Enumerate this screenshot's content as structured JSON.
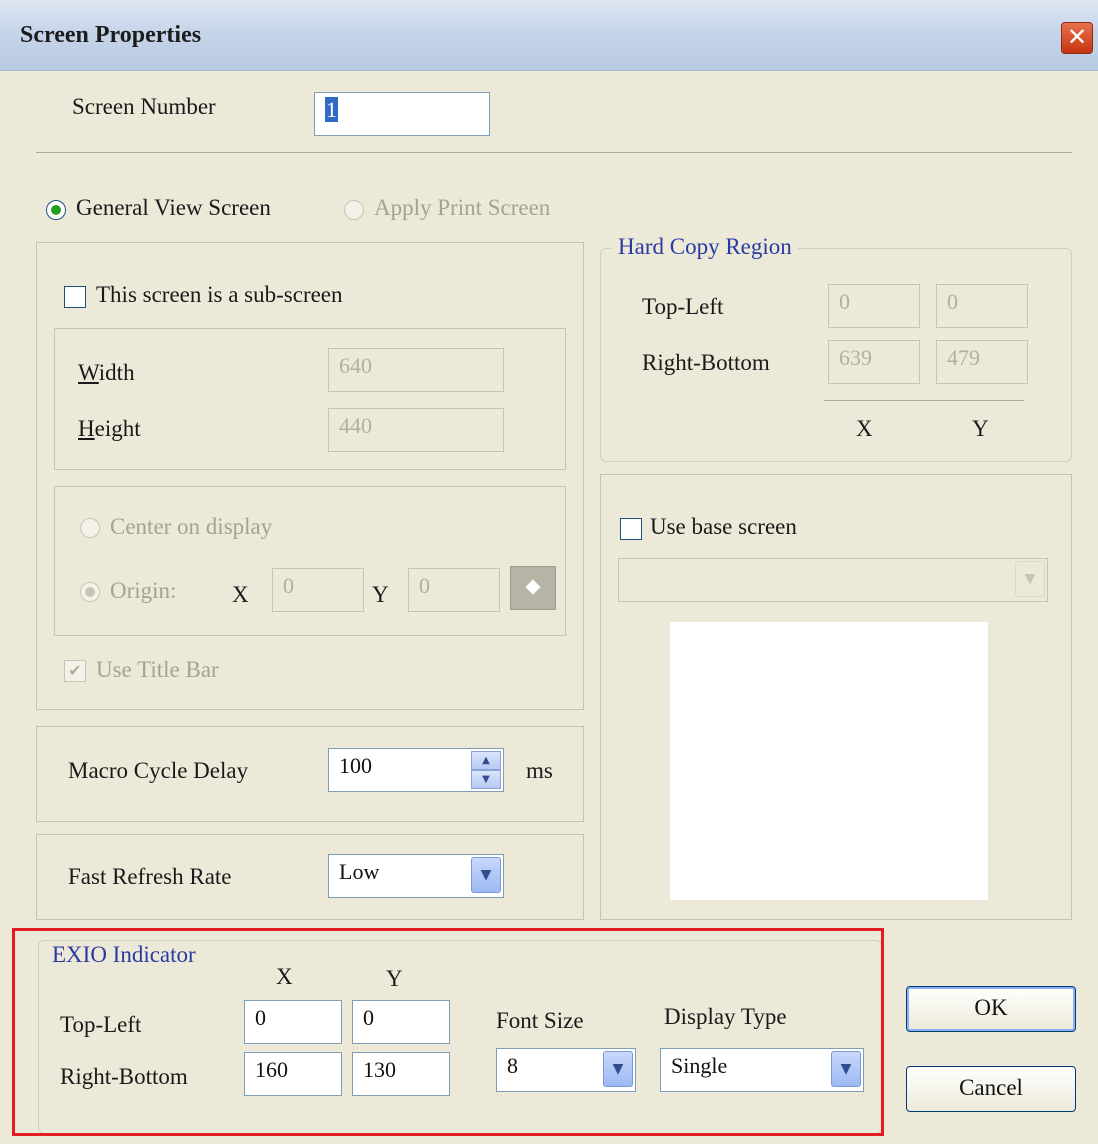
{
  "window": {
    "title": "Screen Properties",
    "close_symbol": "✕"
  },
  "screen_number": {
    "label": "Screen Number",
    "value": "1"
  },
  "screen_type": {
    "general": "General View Screen",
    "print": "Apply Print Screen"
  },
  "subscreen": {
    "checkbox_label": "This screen is a sub-screen",
    "width_label_u": "W",
    "width_label_rest": "idth",
    "width_value": "640",
    "height_label_u": "H",
    "height_label_rest": "eight",
    "height_value": "440",
    "center_label": "Center on display",
    "origin_label": "Origin:",
    "x_label": "X",
    "x_value": "0",
    "y_label": "Y",
    "y_value": "0",
    "use_title_bar": "Use Title Bar"
  },
  "hard_copy": {
    "legend": "Hard Copy Region",
    "top_left_label": "Top-Left",
    "top_left_x": "0",
    "top_left_y": "0",
    "right_bottom_label": "Right-Bottom",
    "right_bottom_x": "639",
    "right_bottom_y": "479",
    "x_header": "X",
    "y_header": "Y"
  },
  "base_screen": {
    "checkbox_label": "Use base screen",
    "selected": ""
  },
  "macro": {
    "label": "Macro Cycle Delay",
    "value": "100",
    "unit": "ms"
  },
  "refresh": {
    "label": "Fast Refresh Rate",
    "value": "Low"
  },
  "exio": {
    "legend": "EXIO Indicator",
    "x_header": "X",
    "y_header": "Y",
    "top_left_label": "Top-Left",
    "top_left_x": "0",
    "top_left_y": "0",
    "right_bottom_label": "Right-Bottom",
    "right_bottom_x": "160",
    "right_bottom_y": "130",
    "font_size_label": "Font Size",
    "font_size_value": "8",
    "display_type_label": "Display Type",
    "display_type_value": "Single"
  },
  "buttons": {
    "ok": "OK",
    "cancel": "Cancel"
  },
  "icons": {
    "dropdown": "▼",
    "spin_up": "▲",
    "spin_down": "▼",
    "check": "✔",
    "pick": "⬥"
  },
  "colors": {
    "dialog_bg": "#ece9d8",
    "legend_blue": "#2a3aa3",
    "highlight_red": "#e02020",
    "close_red": "#c63413"
  }
}
